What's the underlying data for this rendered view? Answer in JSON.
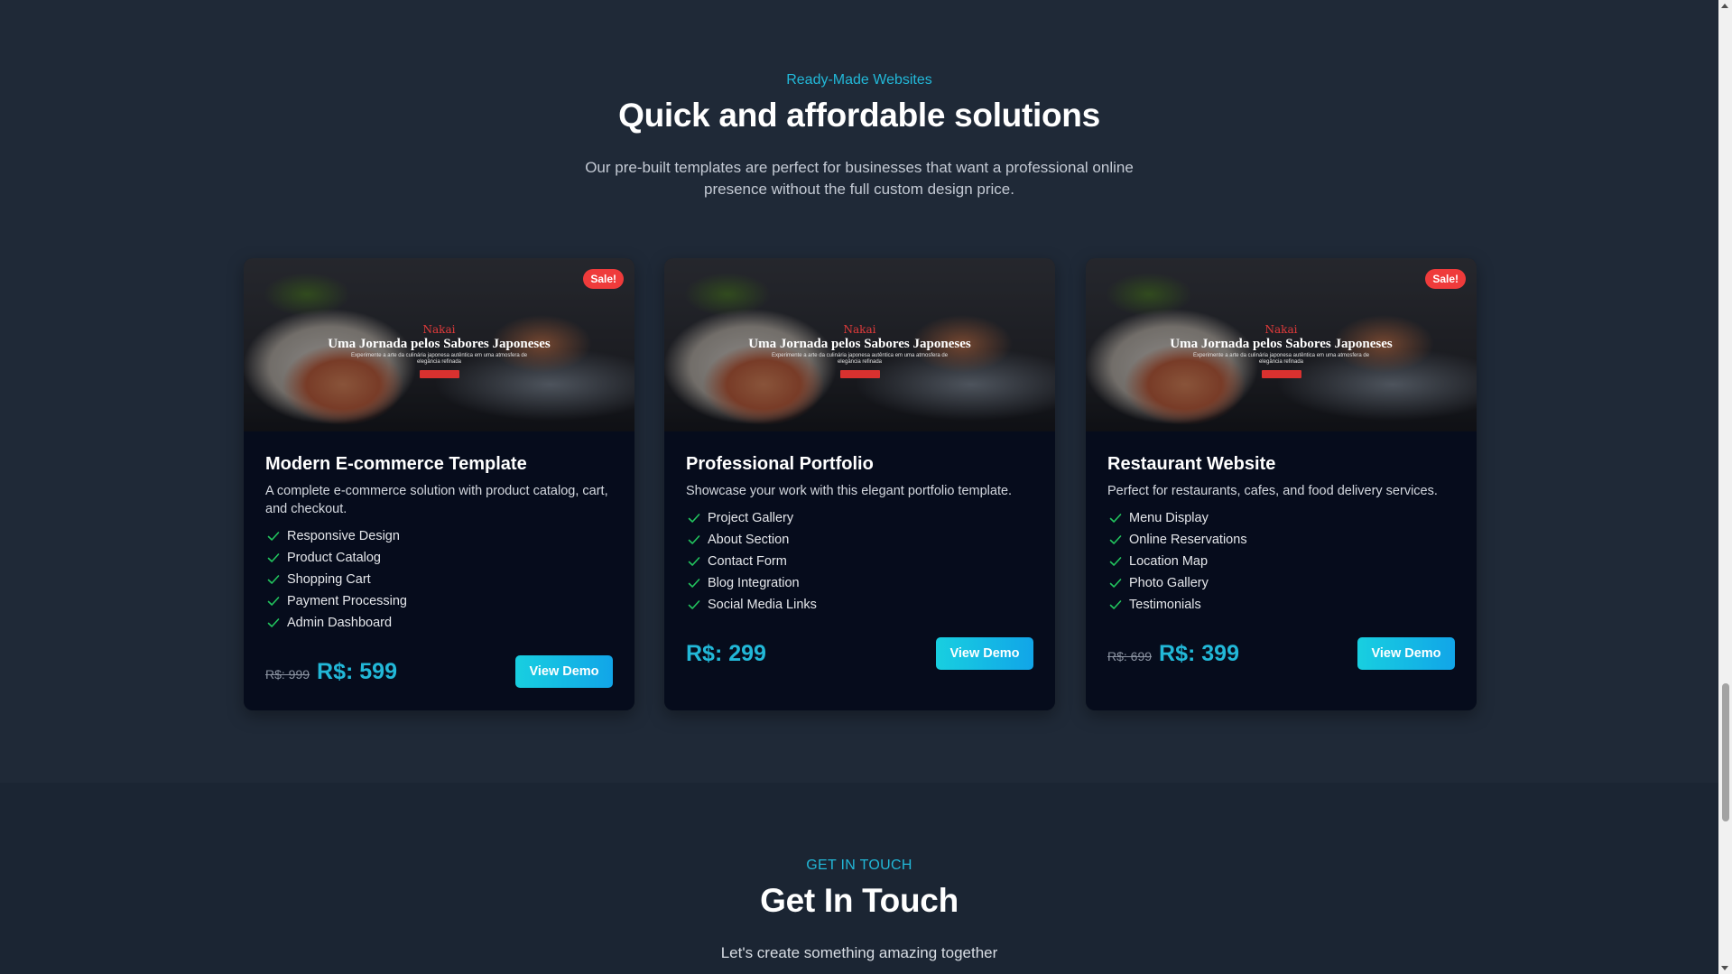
{
  "templates_section": {
    "eyebrow": "Ready-Made Websites",
    "headline": "Quick and affordable solutions",
    "lede": "Our pre-built templates are perfect for businesses that want a professional online presence without the full custom design price."
  },
  "thumbnail": {
    "brand": "Nakai",
    "title": "Uma Jornada pelos Sabores Japoneses",
    "subtitle": "Experimente a arte da culinária japonesa autêntica em uma atmosfera de elegância refinada"
  },
  "cards": [
    {
      "sale_badge": "Sale!",
      "title": "Modern E-commerce Template",
      "description": "A complete e-commerce solution with product catalog, cart, and checkout.",
      "features": [
        "Responsive Design",
        "Product Catalog",
        "Shopping Cart",
        "Payment Processing",
        "Admin Dashboard"
      ],
      "old_price": "R$: 999",
      "price": "R$: 599",
      "button": "View Demo"
    },
    {
      "title": "Professional Portfolio",
      "description": "Showcase your work with this elegant portfolio template.",
      "features": [
        "Project Gallery",
        "About Section",
        "Contact Form",
        "Blog Integration",
        "Social Media Links"
      ],
      "price": "R$: 299",
      "button": "View Demo"
    },
    {
      "sale_badge": "Sale!",
      "title": "Restaurant Website",
      "description": "Perfect for restaurants, cafes, and food delivery services.",
      "features": [
        "Menu Display",
        "Online Reservations",
        "Location Map",
        "Photo Gallery",
        "Testimonials"
      ],
      "old_price": "R$: 699",
      "price": "R$: 399",
      "button": "View Demo"
    }
  ],
  "contact_section": {
    "eyebrow": "GET IN TOUCH",
    "headline": "Get In Touch",
    "lede": "Let's create something amazing together"
  },
  "colors": {
    "accent": "#22b8d8",
    "sale": "#ef3b3b",
    "card_bg": "#060c1c",
    "page_bg": "#1f2937"
  },
  "icons": {
    "feature_check": "check-icon",
    "scroll_up": "arrow-up-icon",
    "scroll_down": "arrow-down-icon"
  }
}
